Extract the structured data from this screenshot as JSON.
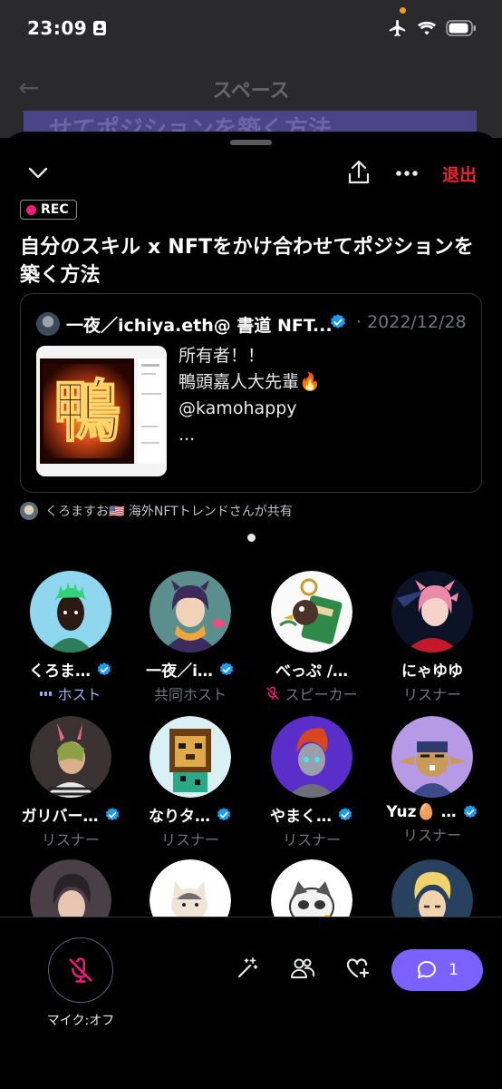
{
  "status_bar": {
    "time": "23:09"
  },
  "background_screen": {
    "title": "スペース",
    "banner_text": "せてポジションを築く方法"
  },
  "header": {
    "leave_label": "退出"
  },
  "space": {
    "rec_label": "REC",
    "title": "自分のスキル x NFTをかけ合わせてポジションを築く方法"
  },
  "tweet": {
    "author": "一夜／ichiya.eth@ 書道 NFT...",
    "date": "· 2022/12/28",
    "lines": [
      "所有者！！",
      "鴨頭嘉人大先輩🔥",
      "@kamohappy",
      "..."
    ]
  },
  "shared_by": "くろますお🇺🇸 海外NFTトレンドさんが共有",
  "participants": [
    {
      "name": "くろま…",
      "verified": true,
      "role": "ホスト",
      "role_type": "host"
    },
    {
      "name": "一夜／i…",
      "verified": true,
      "role": "共同ホスト",
      "role_type": "cohost"
    },
    {
      "name": "べっぷ /…",
      "verified": false,
      "role": "スピーカー",
      "role_type": "speaker"
    },
    {
      "name": "にゃゆゆ",
      "verified": false,
      "role": "リスナー",
      "role_type": "listener"
    },
    {
      "name": "ガリバー…",
      "verified": true,
      "role": "リスナー",
      "role_type": "listener"
    },
    {
      "name": "なりタ…",
      "verified": true,
      "role": "リスナー",
      "role_type": "listener"
    },
    {
      "name": "やまく…",
      "verified": true,
      "role": "リスナー",
      "role_type": "listener"
    },
    {
      "name": "Yuz🥚 …",
      "verified": true,
      "role": "リスナー",
      "role_type": "listener"
    }
  ],
  "bottom_bar": {
    "mic_label": "マイク:オフ",
    "comment_count": "1"
  },
  "colors": {
    "accent": "#7b61ff",
    "verified": "#1d9bf0",
    "leave": "#f4212e",
    "rec": "#f91880",
    "muted": "#f91880"
  }
}
